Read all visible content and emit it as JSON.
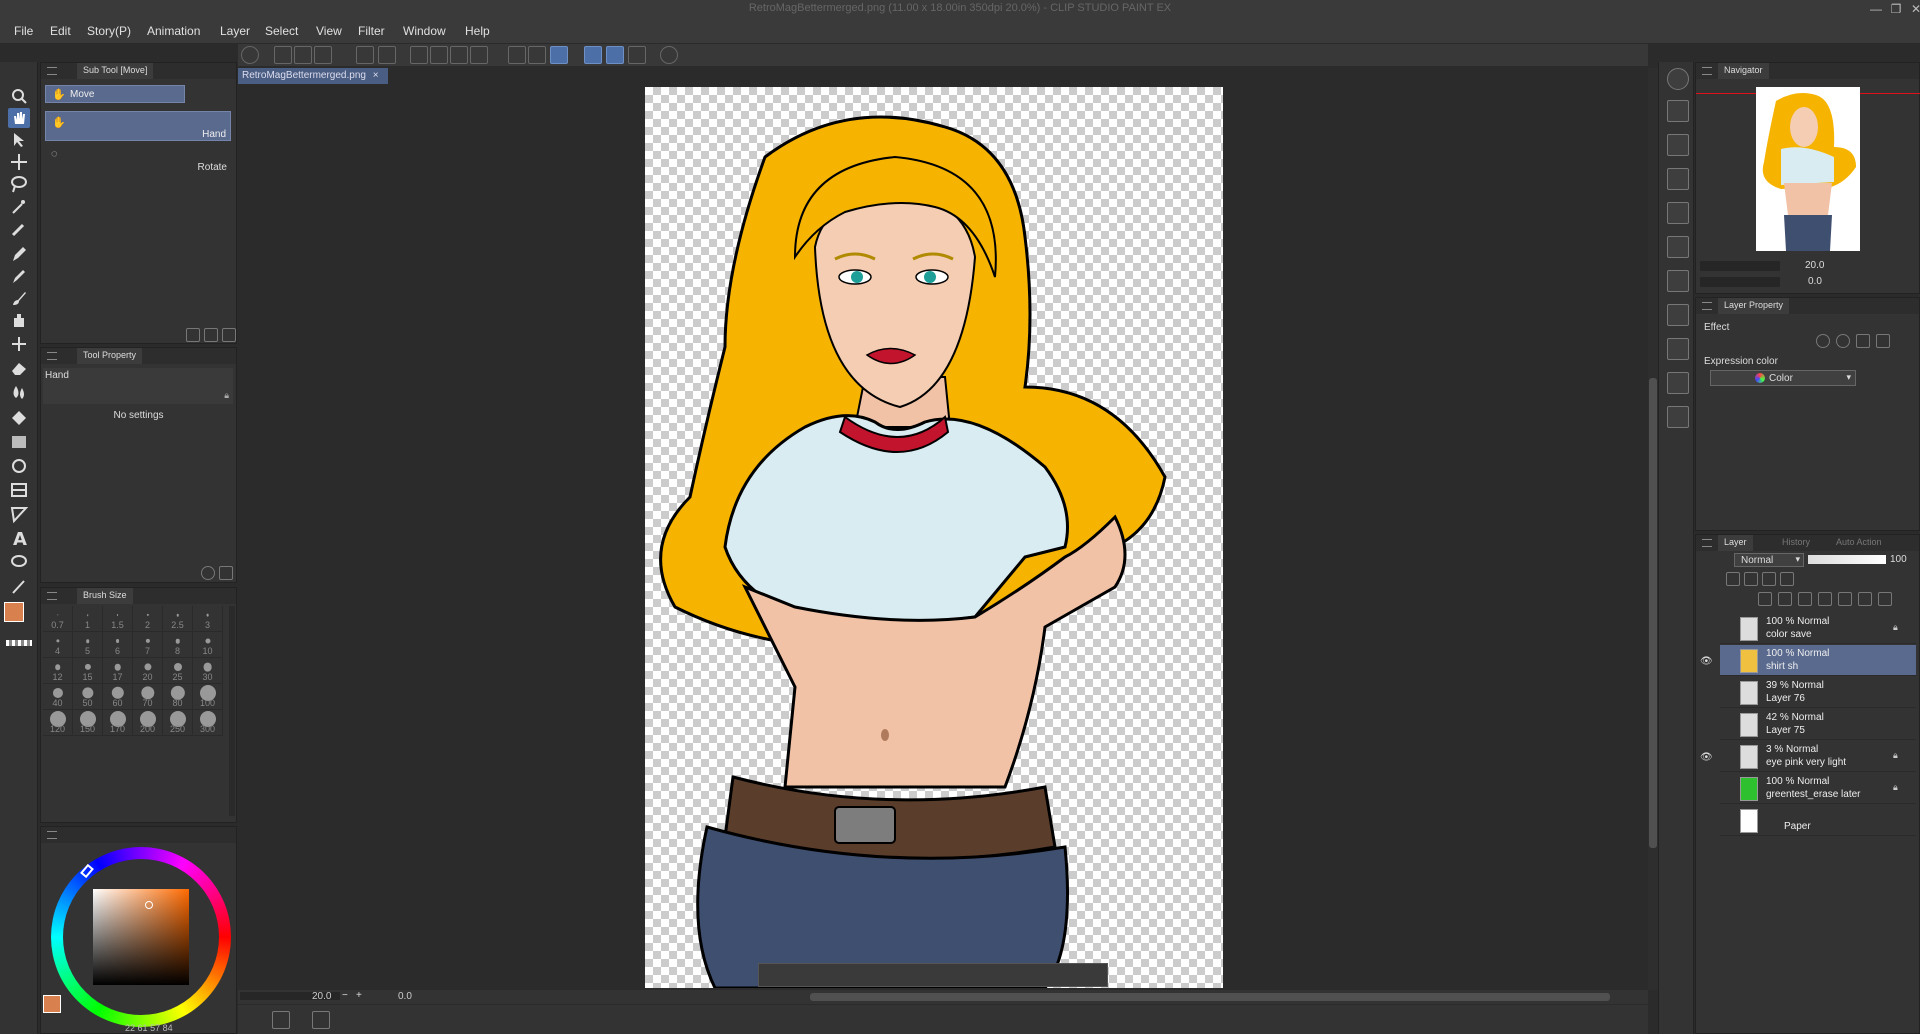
{
  "window": {
    "title": "RetroMagBettermerged.png (11.00 x 18.00in 350dpi 20.0%) - CLIP STUDIO PAINT EX",
    "controls": [
      "—",
      "❐",
      "✕"
    ]
  },
  "menu": [
    "File",
    "Edit",
    "Story(P)",
    "Animation",
    "Layer",
    "Select",
    "View",
    "Filter",
    "Window",
    "Help"
  ],
  "document": {
    "tab_label": "RetroMagBettermerged.png",
    "close": "×"
  },
  "subtool": {
    "header": "Sub Tool [Move]",
    "group": "Move",
    "items": [
      {
        "label": "Hand",
        "icon": "hand-icon"
      },
      {
        "label": "Rotate",
        "icon": "rotate-icon"
      }
    ]
  },
  "tool_property": {
    "header": "Tool Property",
    "tool_name": "Hand",
    "message": "No settings"
  },
  "brush_size": {
    "header": "Brush Size",
    "sizes": [
      "0.7",
      "1",
      "1.5",
      "2",
      "2.5",
      "3",
      "4",
      "5",
      "6",
      "7",
      "8",
      "10",
      "12",
      "15",
      "17",
      "20",
      "25",
      "30",
      "40",
      "50",
      "60",
      "70",
      "80",
      "100",
      "120",
      "150",
      "170",
      "200",
      "250",
      "300"
    ]
  },
  "color": {
    "main": "#d9804f",
    "hue_indicator": "#ffffff",
    "readout": [
      "22",
      "61",
      "57",
      "84"
    ]
  },
  "statusbar": {
    "zoom": "20.0",
    "angle": "0.0"
  },
  "navigator": {
    "header": "Navigator",
    "zoom": "20.0",
    "angle": "0.0"
  },
  "layer_property": {
    "header": "Layer Property",
    "effect_label": "Effect",
    "expression_label": "Expression color",
    "expression_value": "Color"
  },
  "layers": {
    "tabs": [
      "Layer",
      "History",
      "Auto Action"
    ],
    "blend_mode": "Normal",
    "opacity": "100",
    "items": [
      {
        "mode": "100 % Normal",
        "name": "color save",
        "selected": false,
        "visible": false,
        "locked": true,
        "thumb": "#e8e8e8"
      },
      {
        "mode": "100 % Normal",
        "name": "shirt sh",
        "selected": true,
        "visible": true,
        "locked": false,
        "thumb": "#f0c040"
      },
      {
        "mode": "39 % Normal",
        "name": "Layer 76",
        "selected": false,
        "visible": false,
        "locked": false,
        "thumb": "#e8e8e8"
      },
      {
        "mode": "42 % Normal",
        "name": "Layer 75",
        "selected": false,
        "visible": false,
        "locked": false,
        "thumb": "#e8e8e8"
      },
      {
        "mode": "3 % Normal",
        "name": "eye pink very light",
        "selected": false,
        "visible": true,
        "locked": true,
        "thumb": "#e8e8e8"
      },
      {
        "mode": "100 % Normal",
        "name": "greentest_erase later",
        "selected": false,
        "visible": false,
        "locked": true,
        "thumb": "#2fc02f"
      },
      {
        "mode": "",
        "name": "Paper",
        "selected": false,
        "visible": false,
        "locked": false,
        "thumb": "#ffffff"
      }
    ]
  }
}
